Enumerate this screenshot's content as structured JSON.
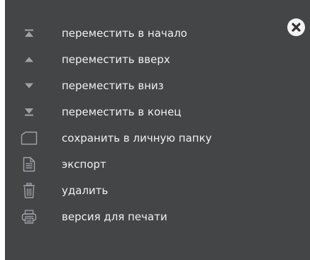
{
  "menu": {
    "close_icon": "close-icon",
    "items": [
      {
        "label": "переместить в начало",
        "icon": "move-to-top-icon"
      },
      {
        "label": "переместить вверх",
        "icon": "move-up-icon"
      },
      {
        "label": "переместить вниз",
        "icon": "move-down-icon"
      },
      {
        "label": "переместить в конец",
        "icon": "move-to-bottom-icon"
      },
      {
        "label": "сохранить в личную папку",
        "icon": "folder-icon"
      },
      {
        "label": "экспорт",
        "icon": "document-icon"
      },
      {
        "label": "удалить",
        "icon": "trash-icon"
      },
      {
        "label": "версия для печати",
        "icon": "printer-icon"
      }
    ]
  },
  "colors": {
    "background": "#434547",
    "text": "#eef0f2",
    "icon": "#9ea3a8",
    "close_bg": "#f4f4f4",
    "close_x": "#333333"
  }
}
